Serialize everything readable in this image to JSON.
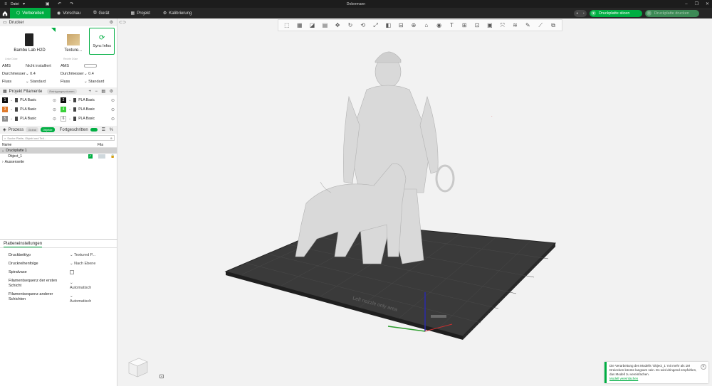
{
  "titlebar": {
    "menu_label": "Datei",
    "window_title": "Dobermann"
  },
  "nav": {
    "tabs": [
      {
        "label": "Vorbereiten"
      },
      {
        "label": "Vorschau"
      },
      {
        "label": "Gerät"
      },
      {
        "label": "Projekt"
      },
      {
        "label": "Kalibrierung"
      }
    ],
    "slice_label": "Druckplatte slicen",
    "print_label": "Druckplatte drucken"
  },
  "printer": {
    "section_title": "Drucker",
    "printer_name": "Bambu Lab H2D",
    "plate_name": "Texture...",
    "sync_label": "Sync Infos",
    "left_small_label": "Linke Düse",
    "right_small_label": "Rechte Düse",
    "left": {
      "ams_label": "AMS",
      "ams_value": "Nicht installiert",
      "diameter_label": "Durchmesser",
      "diameter_value": "0.4",
      "flow_label": "Fluss",
      "flow_value": "Standard"
    },
    "right": {
      "ams_label": "AMS",
      "diameter_label": "Durchmesser",
      "diameter_value": "0.4",
      "flow_label": "Fluss",
      "flow_value": "Standard"
    }
  },
  "filaments": {
    "section_title": "Projekt Filamente",
    "tag": "Reinigungsvolumen",
    "items": [
      {
        "num": "1",
        "name": "PLA Basic",
        "color": "#111111"
      },
      {
        "num": "2",
        "name": "PLA Basic",
        "color": "#111111"
      },
      {
        "num": "3",
        "name": "PLA Basic",
        "color": "#e07a2c"
      },
      {
        "num": "4",
        "name": "PLA Basic",
        "color": "#3ad13a"
      },
      {
        "num": "5",
        "name": "PLA Basic",
        "color": "#8e8e8e"
      },
      {
        "num": "6",
        "name": "PLA Basic",
        "color": "#ffffff"
      }
    ]
  },
  "process": {
    "section_title": "Prozess",
    "global_tag": "Global",
    "objects_tag": "Objekte",
    "advanced_label": "Fortgeschritten",
    "search_placeholder": "Suche Platte, Objekt und Teil...",
    "col_name": "Name",
    "col_fila": "Fila",
    "plate_row": "Druckplatte 1",
    "object_row": "Object_1",
    "outside_row": "Aussenseite"
  },
  "plate_settings": {
    "tab_label": "Platteneinstellungen",
    "rows": [
      {
        "label": "Druckbetttyp",
        "value": "Textured P..."
      },
      {
        "label": "Druckreihenfolge",
        "value": "Nach Ebene"
      },
      {
        "label": "Spiralvase",
        "value": ""
      },
      {
        "label": "Filamentsequenz der ersten Schicht",
        "value": "Automatisch"
      },
      {
        "label": "Filamentsequenz anderer Schichten",
        "value": "Automatisch"
      }
    ]
  },
  "notification": {
    "text": "Die Verarbeitung des Modells 'Object_1' mit mehr als 1M Dreiecken könnte langsam sein. Es wird dringend empfohlen, das Modell zu vereinfachen.",
    "link": "Modell vereinfachen"
  },
  "bed": {
    "text": "Left nozzle only area"
  },
  "colors": {
    "accent": "#00ae42",
    "titlebar": "#1c1c1c",
    "navbar": "#262626"
  }
}
